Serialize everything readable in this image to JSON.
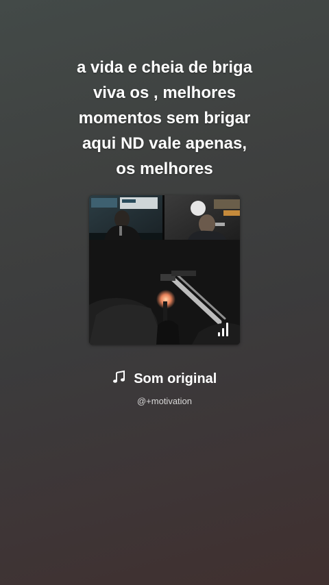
{
  "post": {
    "caption_lines": [
      "a vida e cheia de briga",
      "viva os , melhores",
      "momentos sem brigar",
      "aqui ND vale apenas,",
      "os melhores"
    ]
  },
  "sound": {
    "icon": "music-note-icon",
    "title": "Som original",
    "author": "@+motivation"
  },
  "video": {
    "indicator_icon": "signal-bars-icon"
  },
  "colors": {
    "text_primary": "#ffffff",
    "text_secondary": "#d8d8d8"
  }
}
